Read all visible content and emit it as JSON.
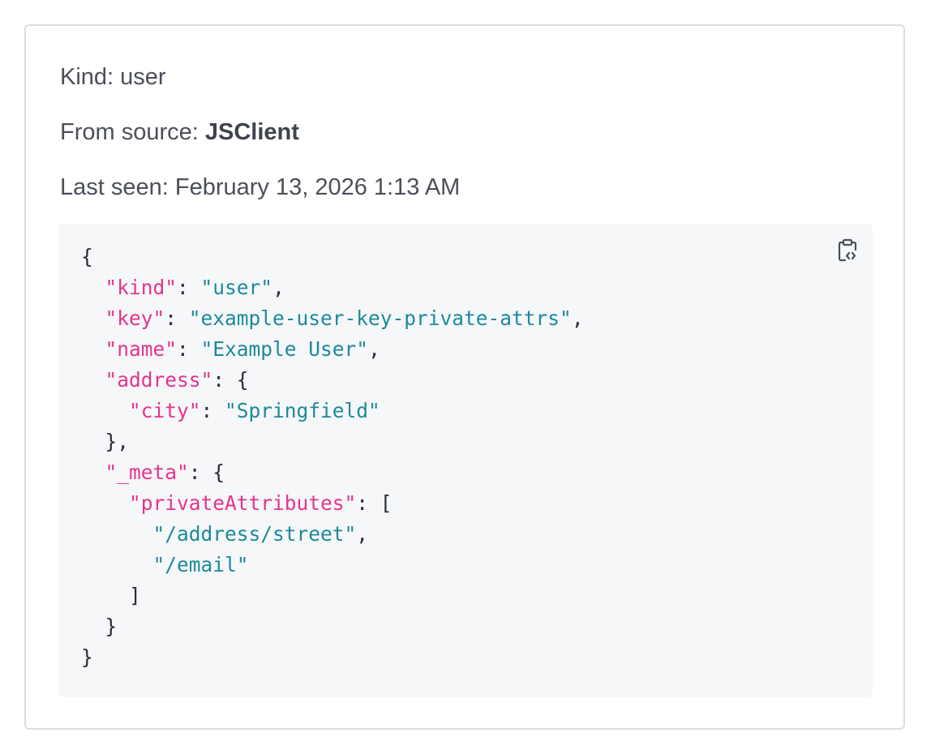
{
  "context": {
    "kind_prefix": "Kind: ",
    "kind_value": "user",
    "source_prefix": "From source: ",
    "source_value": "JSClient",
    "last_seen_prefix": "Last seen: ",
    "last_seen_value": "February 13, 2026 1:13 AM"
  },
  "code_block": {
    "copy_icon": "clipboard-code-icon",
    "json": {
      "kind_key": "\"kind\"",
      "kind_val": "\"user\"",
      "key_key": "\"key\"",
      "key_val": "\"example-user-key-private-attrs\"",
      "name_key": "\"name\"",
      "name_val": "\"Example User\"",
      "address_key": "\"address\"",
      "city_key": "\"city\"",
      "city_val": "\"Springfield\"",
      "meta_key": "\"_meta\"",
      "private_key": "\"privateAttributes\"",
      "private_vals": [
        "\"/address/street\"",
        "\"/email\""
      ]
    }
  },
  "colors": {
    "key": "#e6338f",
    "string": "#1c8a9a",
    "code_bg": "#f6f7f9",
    "border": "#dcdde2"
  }
}
